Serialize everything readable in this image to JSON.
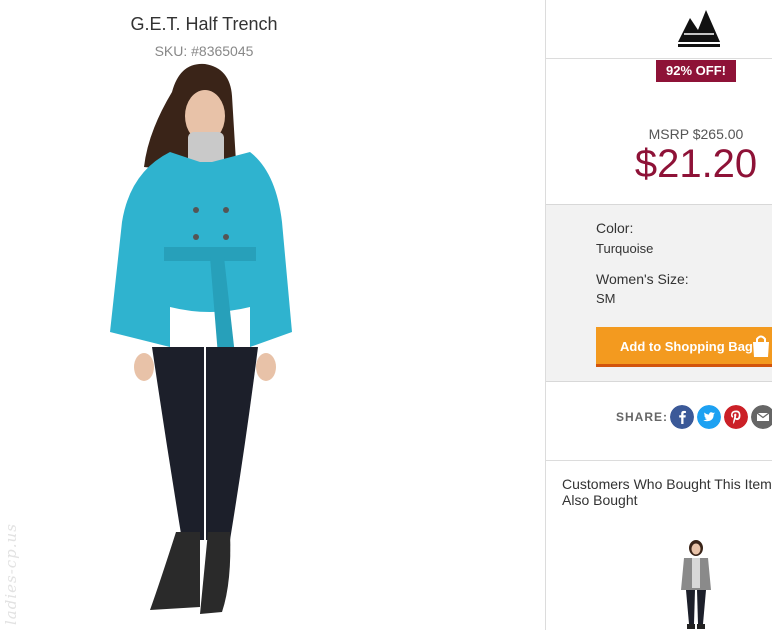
{
  "product": {
    "title": "G.E.T. Half Trench",
    "sku": "SKU: #8365045"
  },
  "watermark": "ladies-cp.us",
  "pricing": {
    "discount_badge": "92% OFF!",
    "msrp": "MSRP $265.00",
    "price": "$21.20"
  },
  "options": {
    "color_label": "Color:",
    "color_value": "Turquoise",
    "size_label": "Women's Size:",
    "size_value": "SM"
  },
  "actions": {
    "add_to_bag": "Add to Shopping Bag"
  },
  "share": {
    "label": "SHARE:",
    "networks": [
      "facebook-icon",
      "twitter-icon",
      "pinterest-icon",
      "email-icon"
    ]
  },
  "recommendations": {
    "heading": "Customers Who Bought This Item Also Bought"
  },
  "colors": {
    "accent": "#8e1237",
    "button": "#f39a1f",
    "facebook": "#3b5998",
    "twitter": "#1da1f2",
    "pinterest": "#cb2027",
    "email": "#666666"
  }
}
